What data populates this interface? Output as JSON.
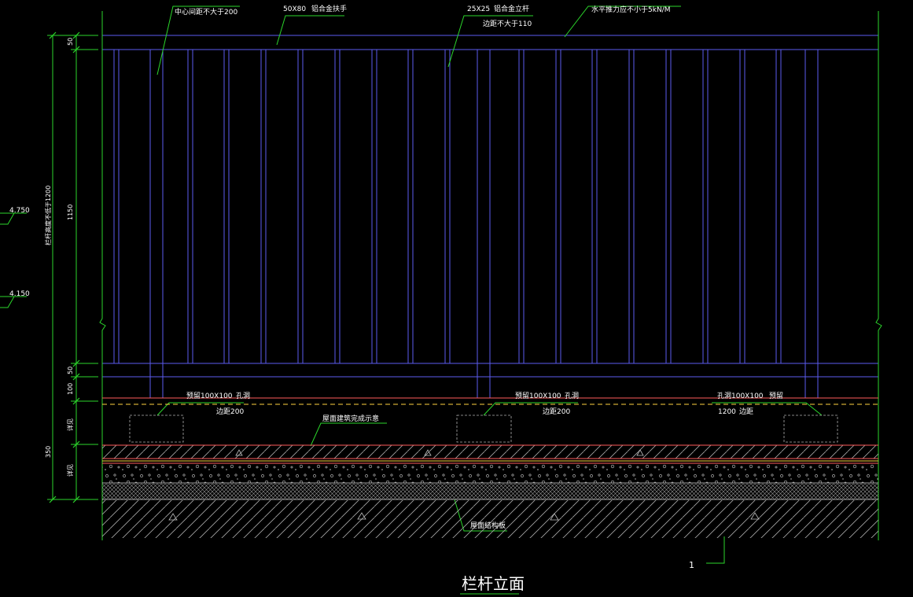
{
  "title": "栏杆立面",
  "detail_ref": "1",
  "annotations": {
    "spacing": "中心间距不大于200",
    "handrail_size": "50X80",
    "handrail_name": "铝合金扶手",
    "post_size": "25X25",
    "post_name": "铝合金立杆",
    "post_edge": "边距不大于110",
    "horizontal_force": "水平推力应不小于5kN/M",
    "hole_left_a": "预留100X100",
    "hole_left_b": "孔洞",
    "hole_left_c": "边距200",
    "hole_mid_a": "预留100X100",
    "hole_mid_b": "孔洞",
    "hole_mid_c": "边距200",
    "hole_right_a": "孔洞100X100",
    "hole_right_b": "预留",
    "hole_right_c": "1200",
    "hole_right_d": "边距",
    "finish_surface": "屋面建筑完成示意",
    "structure_slab": "屋面结构板"
  },
  "dimensions": {
    "d_top": "50",
    "d_mid": "1150",
    "d_bot": "50",
    "d_curb": "100",
    "d_base": "350",
    "d_total": "栏杆高度不低于1200",
    "d_layer1": "详见",
    "d_layer2": "详见"
  },
  "levels": {
    "level_upper": "4.750",
    "level_lower": "4.150"
  },
  "colors": {
    "dimension": "#2bd62b",
    "railing": "#5c5cf0",
    "text": "#ffffff",
    "slab": "#ff5c5c",
    "hidden": "#ffd23f",
    "hatch": "#bfbfbf"
  }
}
